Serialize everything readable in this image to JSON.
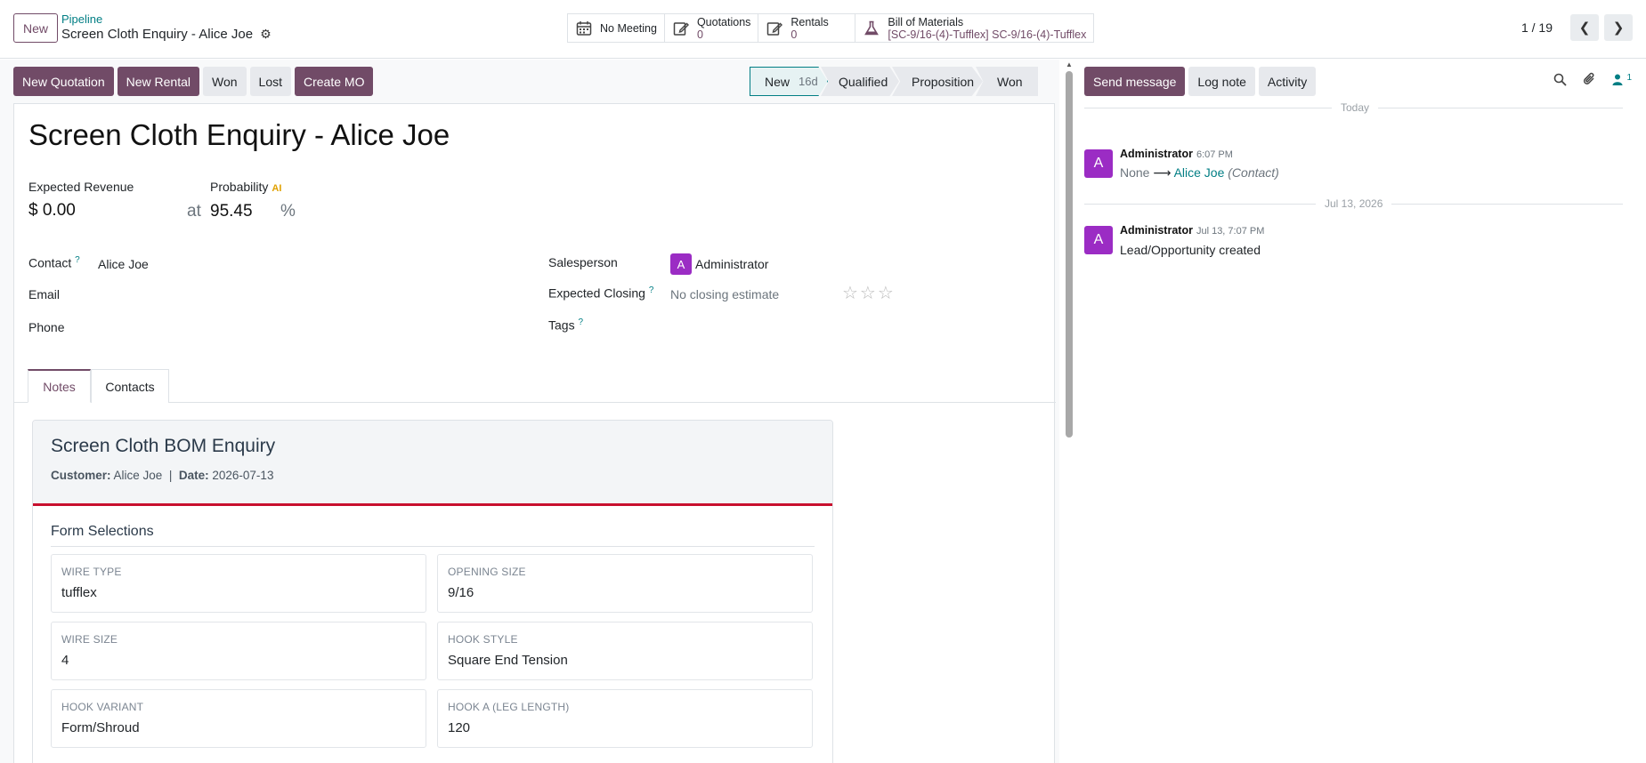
{
  "header": {
    "new_label": "New",
    "breadcrumb_parent": "Pipeline",
    "breadcrumb_current": "Screen Cloth Enquiry - Alice Joe",
    "smart_buttons": [
      {
        "label": "No Meeting",
        "count": ""
      },
      {
        "label": "Quotations",
        "count": "0"
      },
      {
        "label": "Rentals",
        "count": "0"
      },
      {
        "label": "Bill of Materials",
        "count": "[SC-9/16-(4)-Tufflex] SC-9/16-(4)-Tufflex"
      }
    ],
    "pager_value": "1 / 19"
  },
  "statusbar": {
    "buttons": [
      "New Quotation",
      "New Rental",
      "Won",
      "Lost",
      "Create MO"
    ],
    "stages": [
      {
        "label": "New",
        "days": "16d"
      },
      {
        "label": "Qualified"
      },
      {
        "label": "Proposition"
      },
      {
        "label": "Won"
      }
    ]
  },
  "form": {
    "title": "Screen Cloth Enquiry - Alice Joe",
    "expected_revenue_label": "Expected Revenue",
    "expected_revenue": "$ 0.00",
    "at_label": "at",
    "probability_label": "Probability",
    "ai_badge": "AI",
    "probability": "95.45",
    "percent": "%",
    "contact_label": "Contact",
    "help_mark": "?",
    "contact_value": "Alice Joe",
    "email_label": "Email",
    "phone_label": "Phone",
    "salesperson_label": "Salesperson",
    "salesperson_initial": "A",
    "salesperson_value": "Administrator",
    "expected_closing_label": "Expected Closing",
    "expected_closing_value": "No closing estimate",
    "priority_stars": "☆☆☆",
    "tags_label": "Tags",
    "tabs": [
      "Notes",
      "Contacts"
    ]
  },
  "bom": {
    "title": "Screen Cloth BOM Enquiry",
    "customer_label": "Customer:",
    "customer": "Alice Joe",
    "separator": "|",
    "date_label": "Date:",
    "date": "2026-07-13",
    "section_title": "Form Selections",
    "fields": [
      {
        "key": "Wire Type",
        "value": "tufflex"
      },
      {
        "key": "Opening Size",
        "value": "9/16"
      },
      {
        "key": "Wire Size",
        "value": "4"
      },
      {
        "key": "Hook Style",
        "value": "Square End Tension"
      },
      {
        "key": "Hook Variant",
        "value": "Form/Shroud"
      },
      {
        "key": "Hook A (Leg Length)",
        "value": "120"
      }
    ]
  },
  "chatter": {
    "buttons": [
      "Send message",
      "Log note",
      "Activity"
    ],
    "follower_count": "1",
    "groups": [
      {
        "date": "Today",
        "author": "Administrator",
        "time": "6:07 PM",
        "initial": "A",
        "from": "None",
        "arrow": "⟶",
        "to": "Alice Joe",
        "field": "(Contact)"
      },
      {
        "date": "Jul 13, 2026",
        "author": "Administrator",
        "time": "Jul 13, 7:07 PM",
        "initial": "A",
        "body": "Lead/Opportunity created"
      }
    ]
  },
  "colors": {
    "brand": "#714b67",
    "accent": "#017e84",
    "avatar": "#9b2cc4",
    "bom_rule": "#c8102e"
  }
}
